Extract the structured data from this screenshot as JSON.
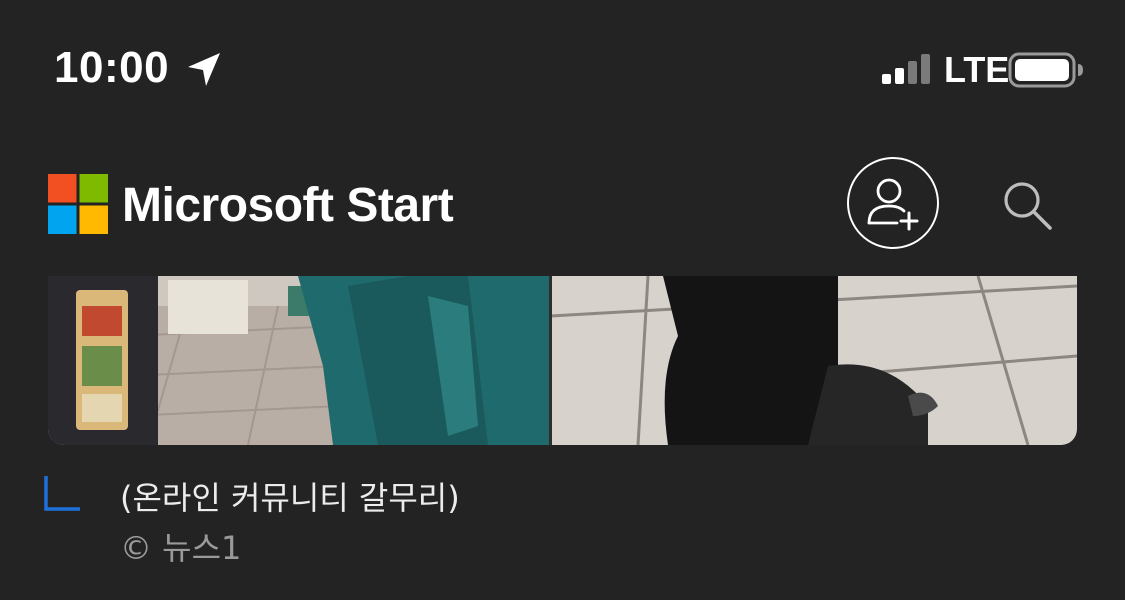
{
  "status_bar": {
    "time": "10:00",
    "network": "LTE",
    "location_icon": "location-arrow-icon",
    "signal_icon": "cellular-signal-icon",
    "battery_icon": "battery-icon"
  },
  "header": {
    "title": "Microsoft Start",
    "logo_icon": "microsoft-logo-icon",
    "add_account_icon": "add-person-icon",
    "search_icon": "search-icon"
  },
  "article": {
    "caption": "(온라인 커뮤니티 갈무리)",
    "credit": "© 뉴스1"
  },
  "colors": {
    "background": "#232323",
    "logo_red": "#F25022",
    "logo_green": "#7FBA00",
    "logo_blue": "#00A4EF",
    "logo_yellow": "#FFB900",
    "caption_accent": "#1E6FD9"
  }
}
